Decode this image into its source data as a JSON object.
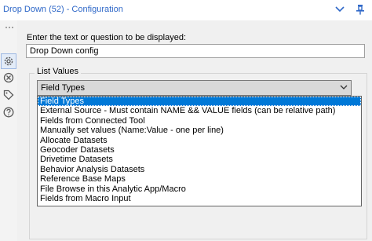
{
  "window": {
    "title": "Drop Down (52) - Configuration"
  },
  "icons": {
    "collapse": "chevron-down-icon",
    "pin": "pin-icon",
    "sidebar": [
      "configuration-gear-icon",
      "annotation-icon",
      "tag-icon",
      "help-icon"
    ]
  },
  "form": {
    "prompt_label": "Enter the text or question to be displayed:",
    "prompt_value": "Drop Down config",
    "list_values_label": "List Values",
    "selected_option": "Field Types",
    "options": [
      "Field Types",
      "External Source - Must contain NAME && VALUE fields  (can be relative path)",
      "Fields from Connected Tool",
      "Manually set values (Name:Value - one per line)",
      "Allocate Datasets",
      "Geocoder Datasets",
      "Drivetime Datasets",
      "Behavior Analysis Datasets",
      "Reference Base Maps",
      "File Browse in this Analytic App/Macro",
      "Fields from Macro Input"
    ]
  },
  "colors": {
    "title_text": "#2f68c8",
    "selection": "#0078d7",
    "panel_background": "#f0f0f0"
  }
}
